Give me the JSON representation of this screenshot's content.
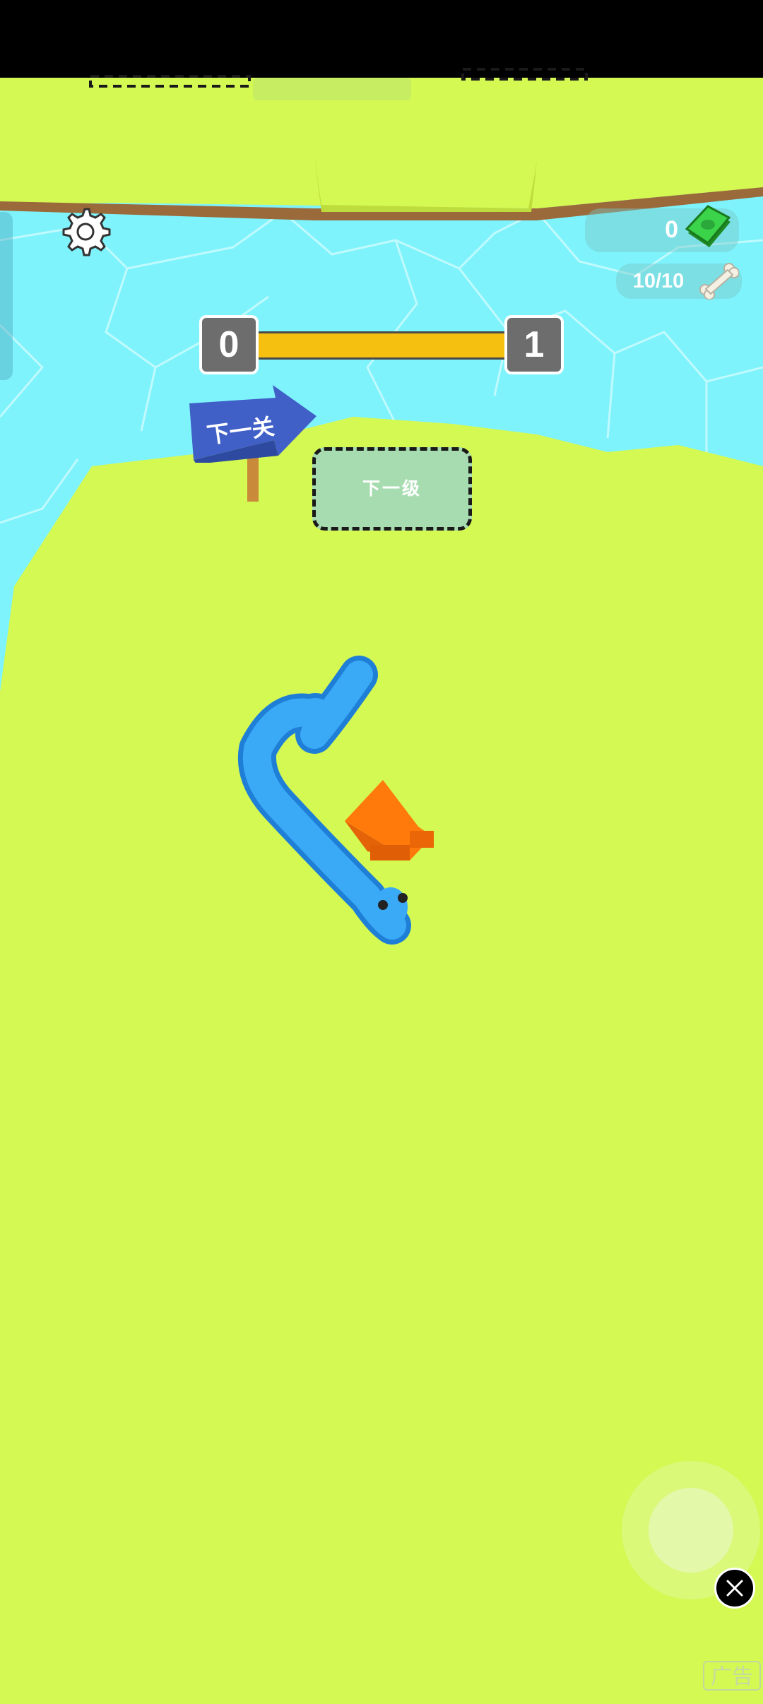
{
  "hud": {
    "cash_count": "0",
    "bone_count": "10/10"
  },
  "level_progress": {
    "current_level": "0",
    "next_level": "1",
    "progress_fraction": 1.0
  },
  "sign": {
    "text": "下一关"
  },
  "zone": {
    "label": "下一级"
  },
  "ad": {
    "label": "广告"
  },
  "colors": {
    "ground": "#d4f953",
    "water": "#7ef3fb",
    "snake": "#2a9bf0",
    "arrow": "#ff7a0a",
    "progress": "#f6c010",
    "sign": "#4060c8"
  },
  "icons": {
    "settings": "gear-icon",
    "cash": "cash-icon",
    "bone": "bone-icon",
    "close": "close-icon"
  }
}
